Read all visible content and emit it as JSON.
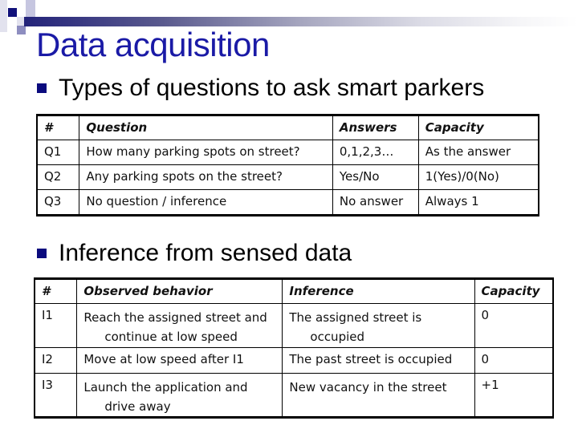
{
  "slide": {
    "title": "Data acquisition",
    "colors": {
      "title": "#1a1aa6",
      "bullet": "#0b0b7e",
      "bar_start": "#23237a"
    }
  },
  "section1": {
    "bullet": "Types of questions to ask smart parkers",
    "headers": [
      "#",
      "Question",
      "Answers",
      "Capacity"
    ],
    "rows": [
      [
        "Q1",
        "How many parking spots on street?",
        "0,1,2,3…",
        "As the answer"
      ],
      [
        "Q2",
        "Any parking spots on the street?",
        "Yes/No",
        "1(Yes)/0(No)"
      ],
      [
        "Q3",
        "No question / inference",
        "No answer",
        "Always 1"
      ]
    ]
  },
  "section2": {
    "bullet": "Inference from sensed data",
    "headers": [
      "#",
      "Observed behavior",
      "Inference",
      "Capacity"
    ],
    "rows": [
      {
        "id": "I1",
        "behavior": [
          "Reach the assigned street and",
          "continue at low speed"
        ],
        "inference": [
          "The assigned street is",
          "occupied"
        ],
        "capacity": "0"
      },
      {
        "id": "I2",
        "behavior": [
          "Move at low speed after I1"
        ],
        "inference": [
          "The past street is occupied"
        ],
        "capacity": "0"
      },
      {
        "id": "I3",
        "behavior": [
          "Launch the application and",
          "drive away"
        ],
        "inference": [
          "New vacancy in the street"
        ],
        "capacity": "+1"
      }
    ]
  }
}
